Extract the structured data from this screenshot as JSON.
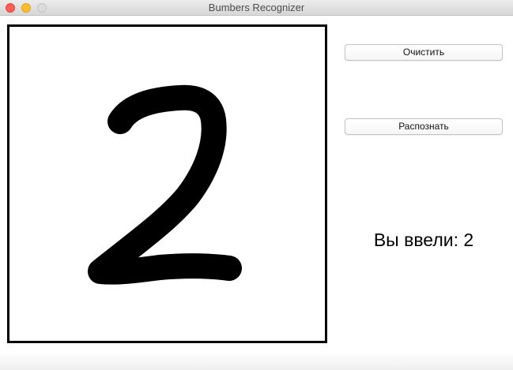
{
  "window": {
    "title": "Bumbers Recognizer"
  },
  "canvas": {
    "drawn_digit_shape": "handwritten-2",
    "stroke_color": "#000000",
    "background_color": "#ffffff"
  },
  "buttons": {
    "clear_label": "Очистить",
    "recognize_label": "Распознать"
  },
  "result": {
    "text": "Вы ввели: 2"
  },
  "colors": {
    "close": "#fc5f57",
    "minimize": "#fdbc2e",
    "zoom": "#dcdcdc"
  }
}
